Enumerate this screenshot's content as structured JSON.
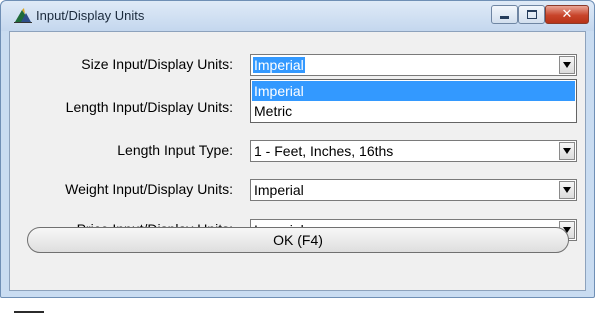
{
  "window": {
    "title": "Input/Display Units",
    "minimize_icon": "minimize-icon",
    "maximize_icon": "maximize-icon",
    "close_icon": "close-icon",
    "app_icon": "app-logo-icon"
  },
  "form": {
    "fields": [
      {
        "label": "Size Input/Display Units:",
        "value": "Imperial"
      },
      {
        "label": "Length Input/Display Units:",
        "value": ""
      },
      {
        "label": "Length Input Type:",
        "value": "1 - Feet, Inches, 16ths"
      },
      {
        "label": "Weight Input/Display Units:",
        "value": "Imperial"
      },
      {
        "label": "Price Input/Display Units:",
        "value": "Imperial"
      }
    ],
    "dropdown": {
      "options": [
        "Imperial",
        "Metric"
      ],
      "highlighted": "Imperial"
    },
    "ok_label": "OK (F4)"
  },
  "colors": {
    "selection": "#3399ff",
    "title_bar": "#c9dcf1",
    "close_button": "#c8442a"
  }
}
